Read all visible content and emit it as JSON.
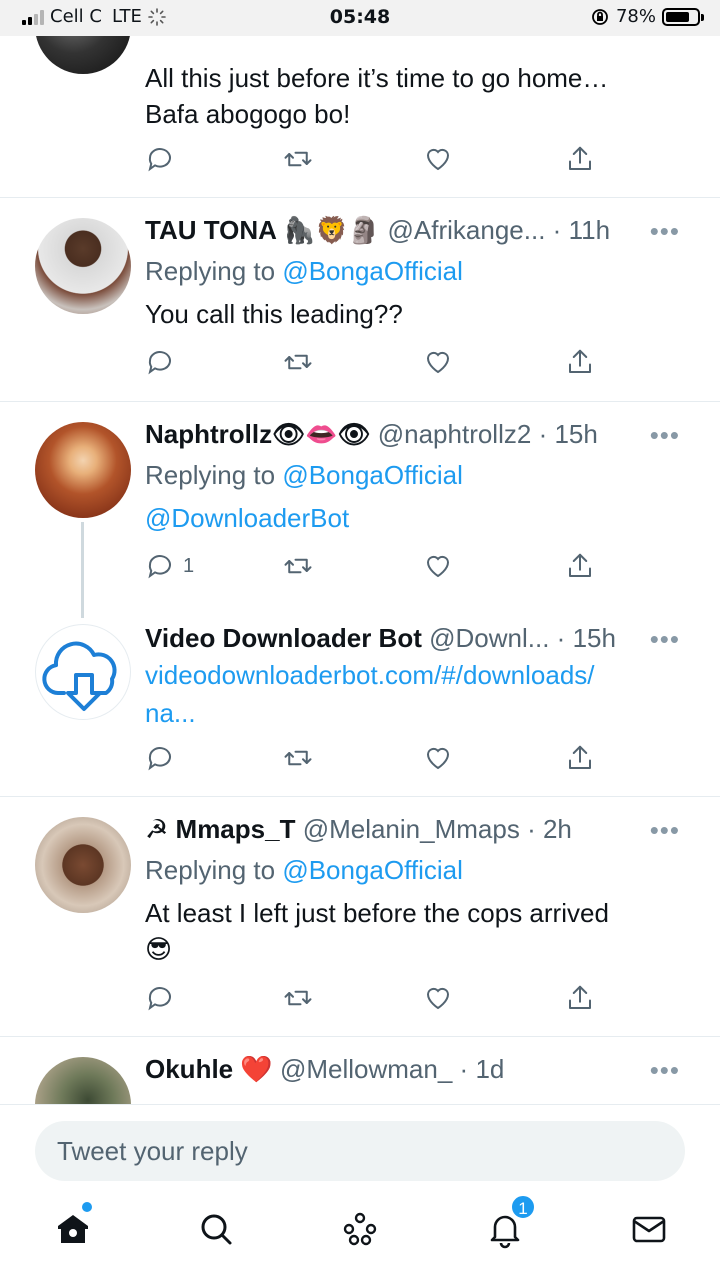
{
  "status_bar": {
    "carrier": "Cell C",
    "network": "LTE",
    "time": "05:48",
    "battery": "78%",
    "battery_level": 0.78
  },
  "tweets": [
    {
      "text_line1": "All this just before it’s time to go home…",
      "text_line2": "Bafa abogogo bo!"
    },
    {
      "name": "TAU TONA 🦍🦁🗿",
      "handle": "@Afrikange...",
      "time": "11h",
      "replying_prefix": "Replying to ",
      "replying_to": "@BongaOfficial",
      "text": "You call this leading??"
    },
    {
      "name": "Naphtrollz👁👄👁",
      "handle": "@naphtrollz2",
      "time": "15h",
      "replying_prefix": "Replying to ",
      "replying_to": "@BongaOfficial",
      "text": "@DownloaderBot",
      "reply_count": "1"
    },
    {
      "name": "Video Downloader Bot",
      "handle": "@Downl...",
      "time": "15h",
      "link_line1": "videodownloaderbot.com/#/downloads/",
      "link_line2": "na..."
    },
    {
      "name": "☭ Mmaps_T",
      "handle": "@Melanin_Mmaps",
      "time": "2h",
      "replying_prefix": "Replying to ",
      "replying_to": "@BongaOfficial",
      "text_line1": "At least I left just before the cops arrived",
      "text_line2": "😎"
    },
    {
      "name": "Okuhle ❤️",
      "handle": "@Mellowman_",
      "time": "1d"
    }
  ],
  "separator_dot": "·",
  "more_glyph": "•••",
  "composer": {
    "placeholder": "Tweet your reply"
  },
  "tabbar": {
    "notifications_count": "1"
  },
  "colors": {
    "accent": "#1d9bf0",
    "secondary_text": "#536471"
  },
  "icons": [
    "reply-icon",
    "retweet-icon",
    "like-icon",
    "share-icon",
    "home-icon",
    "search-icon",
    "spaces-icon",
    "notifications-icon",
    "messages-icon"
  ]
}
